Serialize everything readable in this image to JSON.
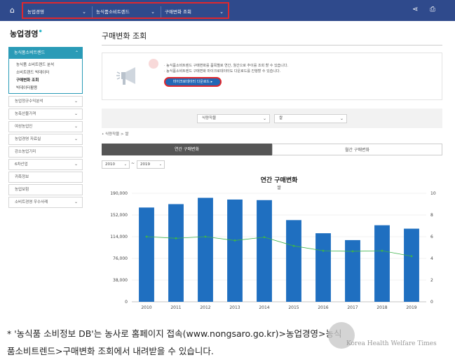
{
  "topbar": {
    "nav": [
      "농업경영",
      "농식품소비트렌드",
      "구매변화 조회"
    ]
  },
  "sidebar": {
    "title": "농업경영",
    "active_item": "농식품소비트렌드",
    "sub_items": [
      "농식품 소비트렌드 분석",
      "소비트렌드 빅데이터",
      "구매변화 조회",
      "빅데이터활용"
    ],
    "items": [
      "농업정규수익분석",
      "농축산물가격",
      "여성농업인",
      "농업경영 자료실",
      "강소농업기리",
      "6차산업",
      "귀촉정보",
      "농업보험",
      "소비트경영 우수사례"
    ]
  },
  "main": {
    "title": "구매변화 조회",
    "notice_lines": [
      "· 농식품소비트렌드 구매변화를 품목별로 연간, 월간으로 추이를 조회 할 수 있습니다.",
      "· 농식품소비트렌드 구매변화 마이크로데이터도 다운로드를 진행할 수 있습니다."
    ],
    "download_button": "마이크로데이터 다운로드 ▸",
    "filter1": "식량작물",
    "filter2": "쌀",
    "source": "• 식량작물 > 쌀",
    "tab_annual": "연간 구매변화",
    "tab_monthly": "월간 구매변화",
    "year_from": "2010",
    "year_to": "2019",
    "tilde": "~"
  },
  "chart_data": {
    "type": "bar",
    "title": "연간 구매변화",
    "subtitle": "쌀",
    "categories": [
      "2010",
      "2011",
      "2012",
      "2013",
      "2014",
      "2015",
      "2016",
      "2017",
      "2018",
      "2019"
    ],
    "series": [
      {
        "kind": "bar",
        "axis": "left",
        "color": "#1f6fc0",
        "values": [
          165000,
          171000,
          182000,
          179000,
          178000,
          143000,
          120000,
          108000,
          134000,
          128000
        ]
      },
      {
        "kind": "line",
        "axis": "right",
        "color": "#3db34a",
        "values": [
          6.0,
          5.85,
          6.0,
          5.65,
          5.95,
          5.15,
          4.7,
          4.65,
          4.7,
          4.2
        ]
      }
    ],
    "left_axis": {
      "ylim": [
        0,
        190000
      ],
      "ticks": [
        "0",
        "38,000",
        "76,000",
        "114,000",
        "152,000",
        "190,000"
      ]
    },
    "right_axis": {
      "ylim": [
        0,
        10
      ],
      "ticks": [
        "0",
        "2",
        "4",
        "6",
        "8",
        "10"
      ]
    }
  },
  "caption": [
    "* '농식품 소비정보 DB'는 농사로 홈페이지 접속(www.nongsaro.go.kr)>농업경영>농식",
    "품소비트렌드>구매변화 조회에서 내려받을 수 있습니다."
  ],
  "watermark": "Korea Health Welfare Times"
}
